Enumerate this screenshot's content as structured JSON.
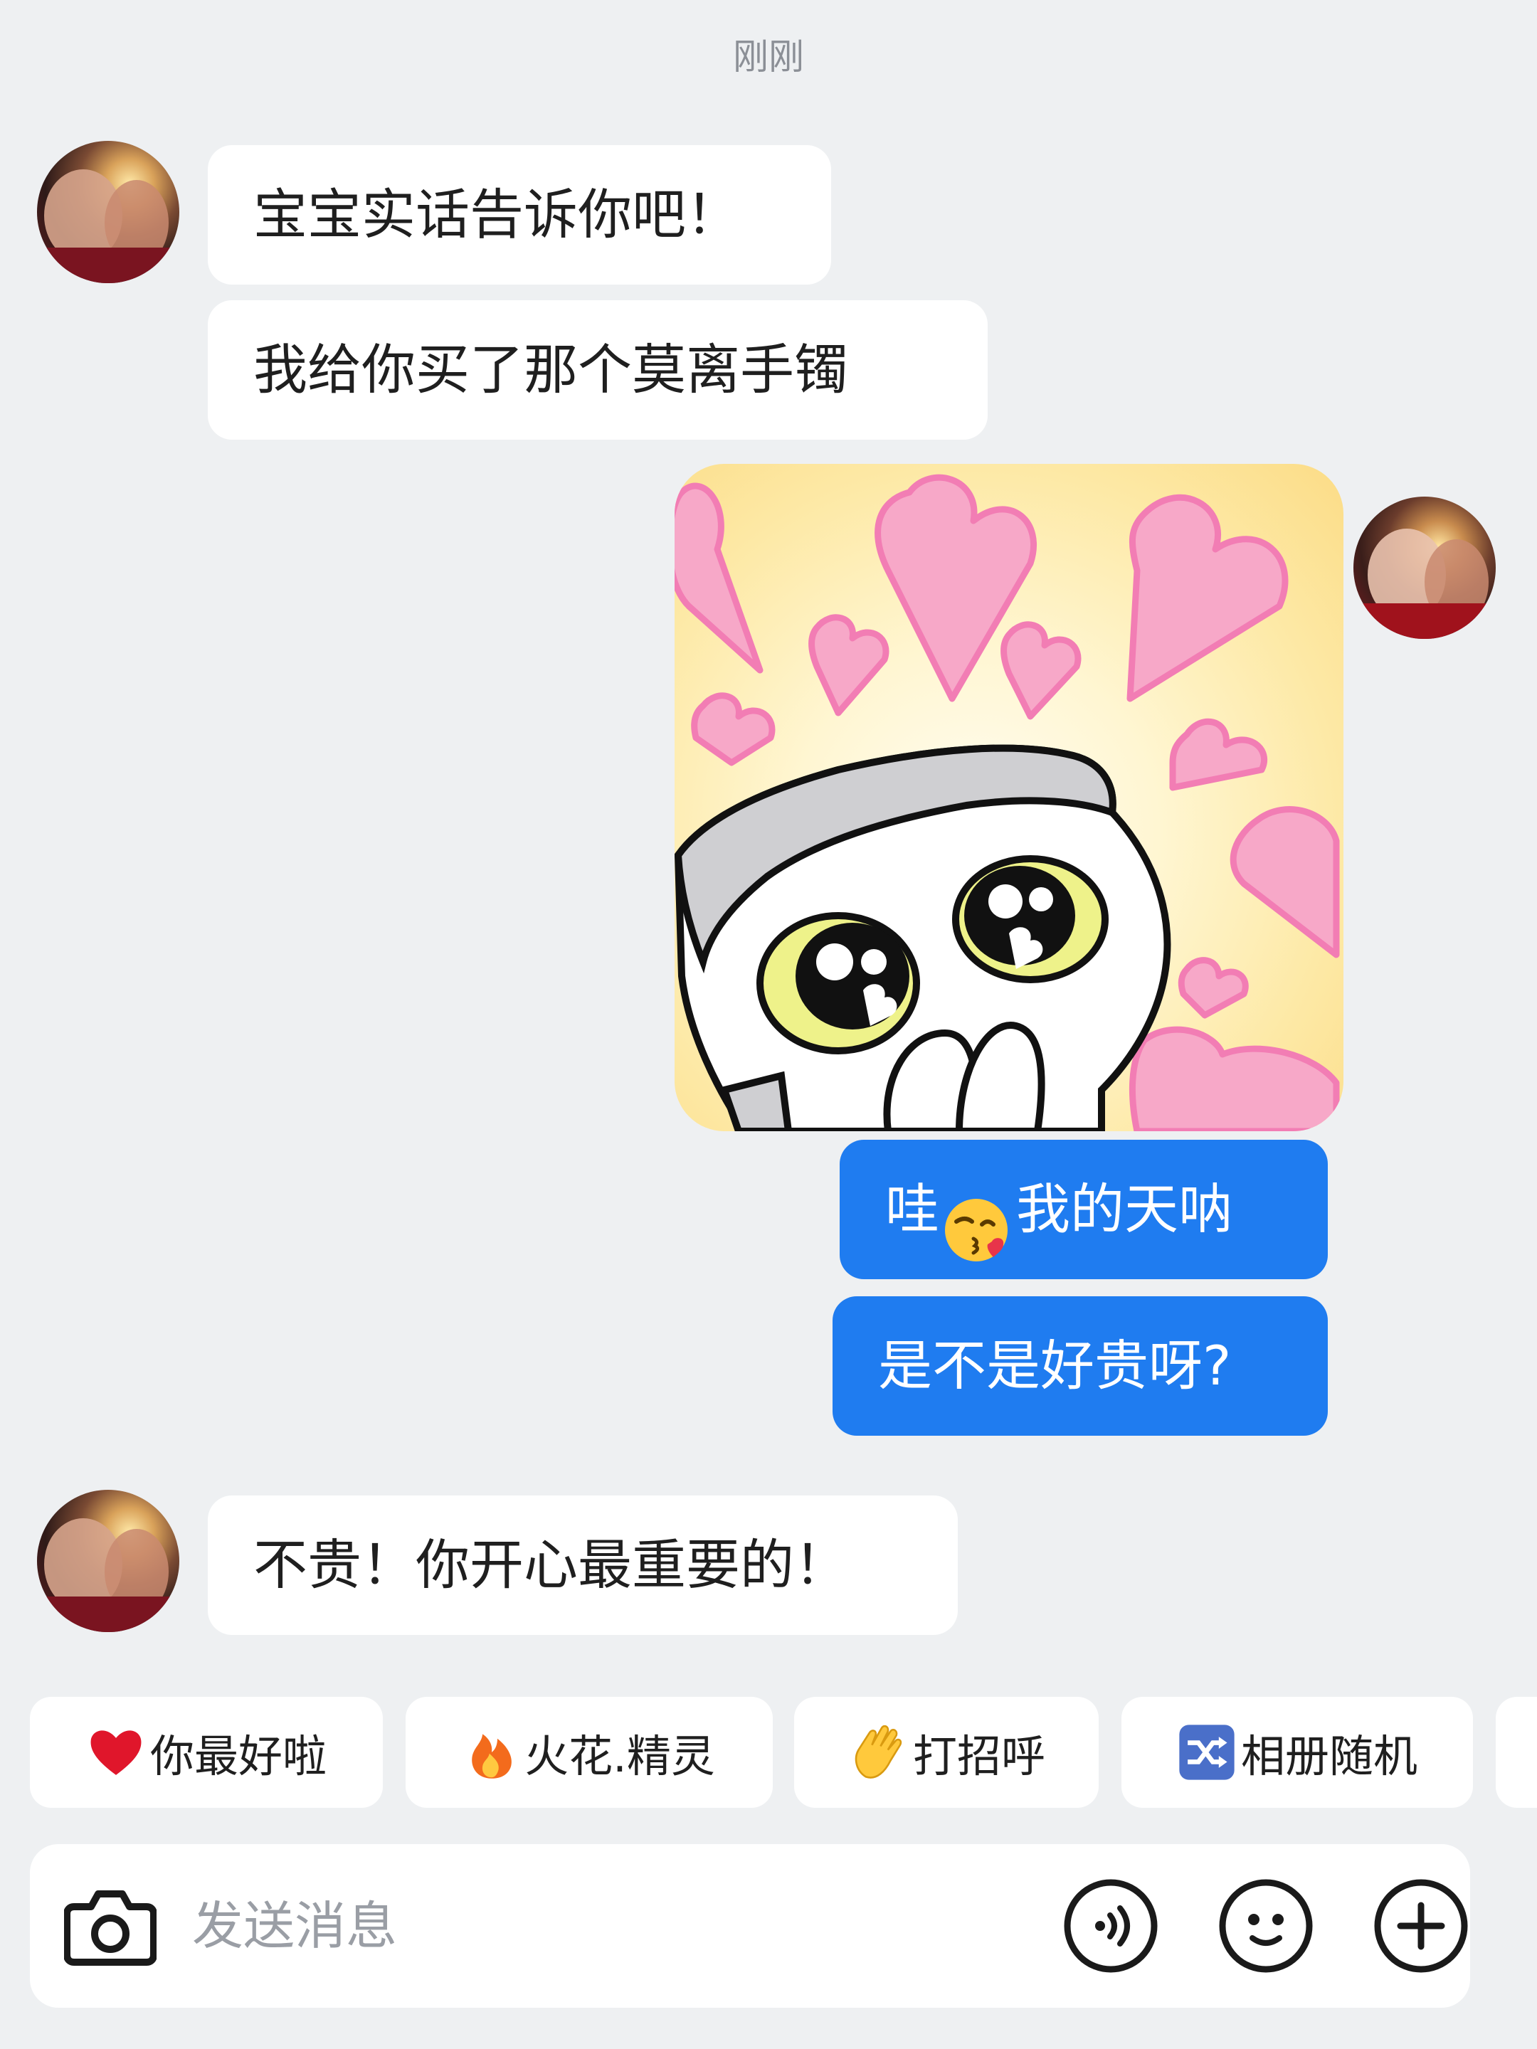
{
  "chat": {
    "timestamp": "刚刚",
    "messages": [
      {
        "from": "other",
        "text": "宝宝实话告诉你吧！"
      },
      {
        "from": "other",
        "text": "我给你买了那个莫离手镯"
      },
      {
        "from": "me",
        "type": "sticker",
        "sticker": "sticker-cat-hearts"
      },
      {
        "from": "me",
        "text_before": "哇",
        "emoji": "kiss-heart-emoji",
        "text_after": "我的天呐"
      },
      {
        "from": "me",
        "text": "是不是好贵呀?"
      },
      {
        "from": "other",
        "text": "不贵！你开心最重要的！"
      }
    ]
  },
  "quick_replies": [
    {
      "icon": "heart-emoji",
      "label": "你最好啦"
    },
    {
      "icon": "fire-emoji",
      "label": "火花.精灵"
    },
    {
      "icon": "wave-emoji",
      "label": "打招呼"
    },
    {
      "icon": "shuffle-icon",
      "label": "相册随机"
    }
  ],
  "composer": {
    "placeholder": "发送消息",
    "icons": [
      "camera-icon",
      "voice-icon",
      "emoji-face-icon",
      "plus-icon"
    ]
  },
  "colors": {
    "background": "#eef0f2",
    "my_bubble": "#1f7cf0",
    "other_bubble": "#ffffff",
    "sticker_heart": "#f7a8c8"
  }
}
